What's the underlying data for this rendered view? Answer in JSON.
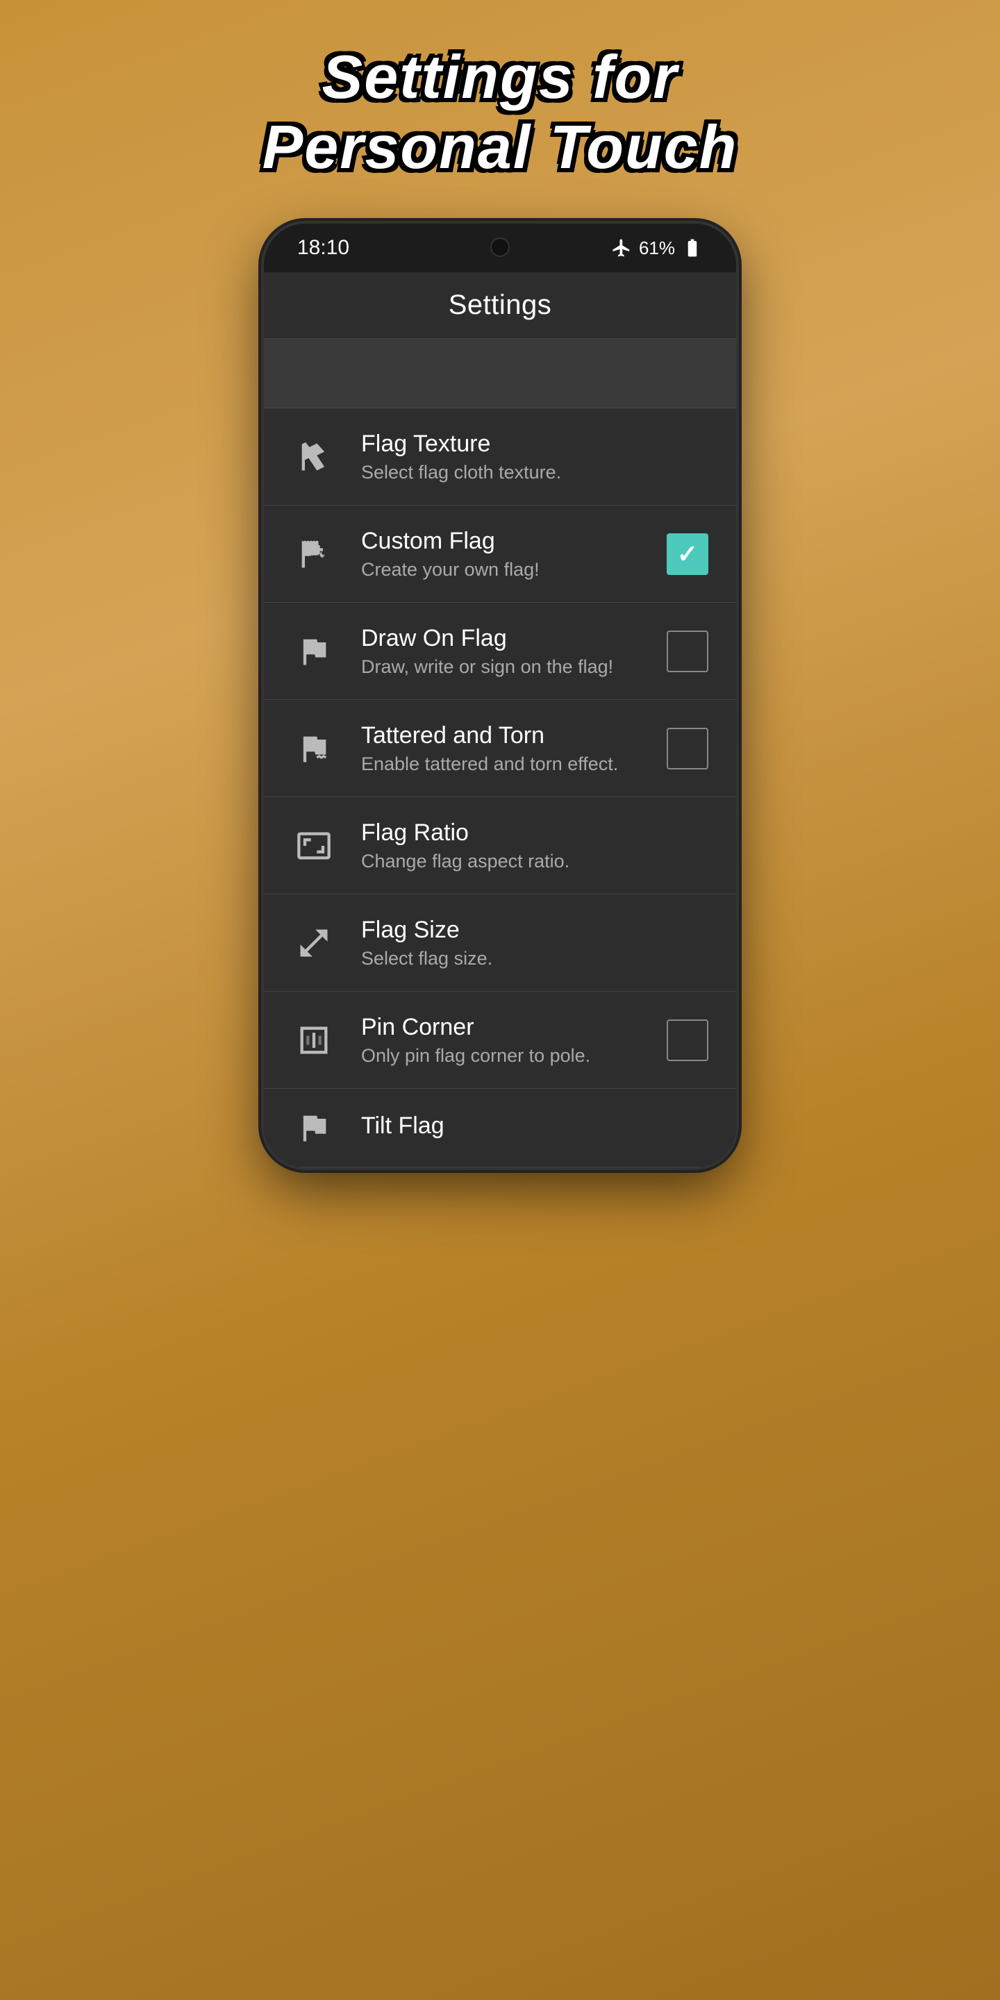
{
  "page": {
    "title_line1": "Settings for",
    "title_line2": "Personal Touch"
  },
  "status_bar": {
    "time": "18:10",
    "battery_percent": "61%",
    "signal_icon": "airplane-mode",
    "battery_icon": "battery"
  },
  "app_bar": {
    "title": "Settings"
  },
  "settings": {
    "items": [
      {
        "id": "flag-texture",
        "icon": "flag-texture-icon",
        "title": "Flag Texture",
        "subtitle": "Select flag cloth texture.",
        "has_checkbox": false,
        "checked": false
      },
      {
        "id": "custom-flag",
        "icon": "custom-flag-icon",
        "title": "Custom Flag",
        "subtitle": "Create your own flag!",
        "has_checkbox": true,
        "checked": true
      },
      {
        "id": "draw-on-flag",
        "icon": "draw-flag-icon",
        "title": "Draw On Flag",
        "subtitle": "Draw, write or sign on the flag!",
        "has_checkbox": true,
        "checked": false
      },
      {
        "id": "tattered-torn",
        "icon": "tattered-flag-icon",
        "title": "Tattered and Torn",
        "subtitle": "Enable tattered and torn effect.",
        "has_checkbox": true,
        "checked": false
      },
      {
        "id": "flag-ratio",
        "icon": "flag-ratio-icon",
        "title": "Flag Ratio",
        "subtitle": "Change flag aspect ratio.",
        "has_checkbox": false,
        "checked": false
      },
      {
        "id": "flag-size",
        "icon": "flag-size-icon",
        "title": "Flag Size",
        "subtitle": "Select flag size.",
        "has_checkbox": false,
        "checked": false
      },
      {
        "id": "pin-corner",
        "icon": "pin-corner-icon",
        "title": "Pin Corner",
        "subtitle": "Only pin flag corner to pole.",
        "has_checkbox": true,
        "checked": false
      },
      {
        "id": "tilt-flag",
        "icon": "tilt-flag-icon",
        "title": "Tilt Flag",
        "subtitle": "",
        "has_checkbox": false,
        "checked": false
      }
    ]
  }
}
